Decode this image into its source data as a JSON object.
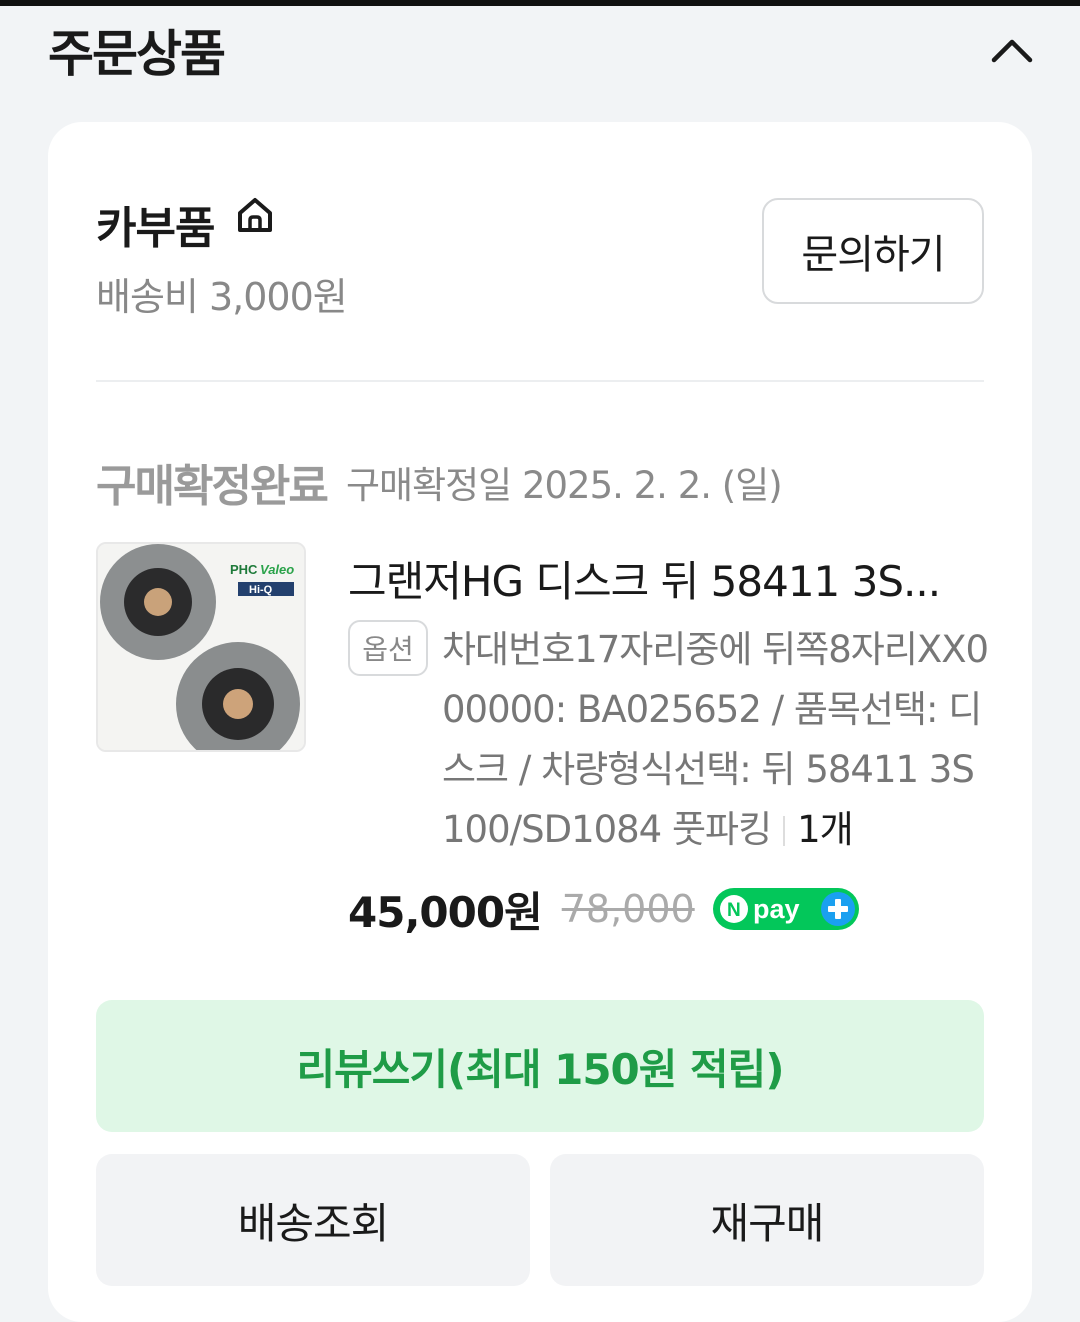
{
  "section": {
    "title": "주문상품"
  },
  "store": {
    "name": "카부품",
    "shipping_fee": "배송비 3,000원",
    "inquiry_label": "문의하기"
  },
  "order": {
    "status": "구매확정완료",
    "confirm_date": "구매확정일 2025. 2. 2. (일)"
  },
  "product": {
    "name": "그랜저HG 디스크 뒤 58411 3S...",
    "option_badge": "옵션",
    "option_text": "차대번호17자리중에 뒤쪽8자리XX000000: BA025652 / 품목선택: 디스크 / 차량형식선택: 뒤 58411 3S100/SD1084 풋파킹",
    "quantity": "1개",
    "sale_price": "45,000원",
    "original_price": "78,000",
    "npay_label": "pay",
    "image_brand_1": "PHC",
    "image_brand_2": "Valeo",
    "image_brand_3": "Hi-Q"
  },
  "actions": {
    "review": "리뷰쓰기(최대 150원 적립)",
    "track_shipping": "배송조회",
    "rebuy": "재구매"
  },
  "colors": {
    "accent_green": "#03c75a",
    "review_bg": "#dff7e6",
    "review_text": "#1f9c47"
  }
}
